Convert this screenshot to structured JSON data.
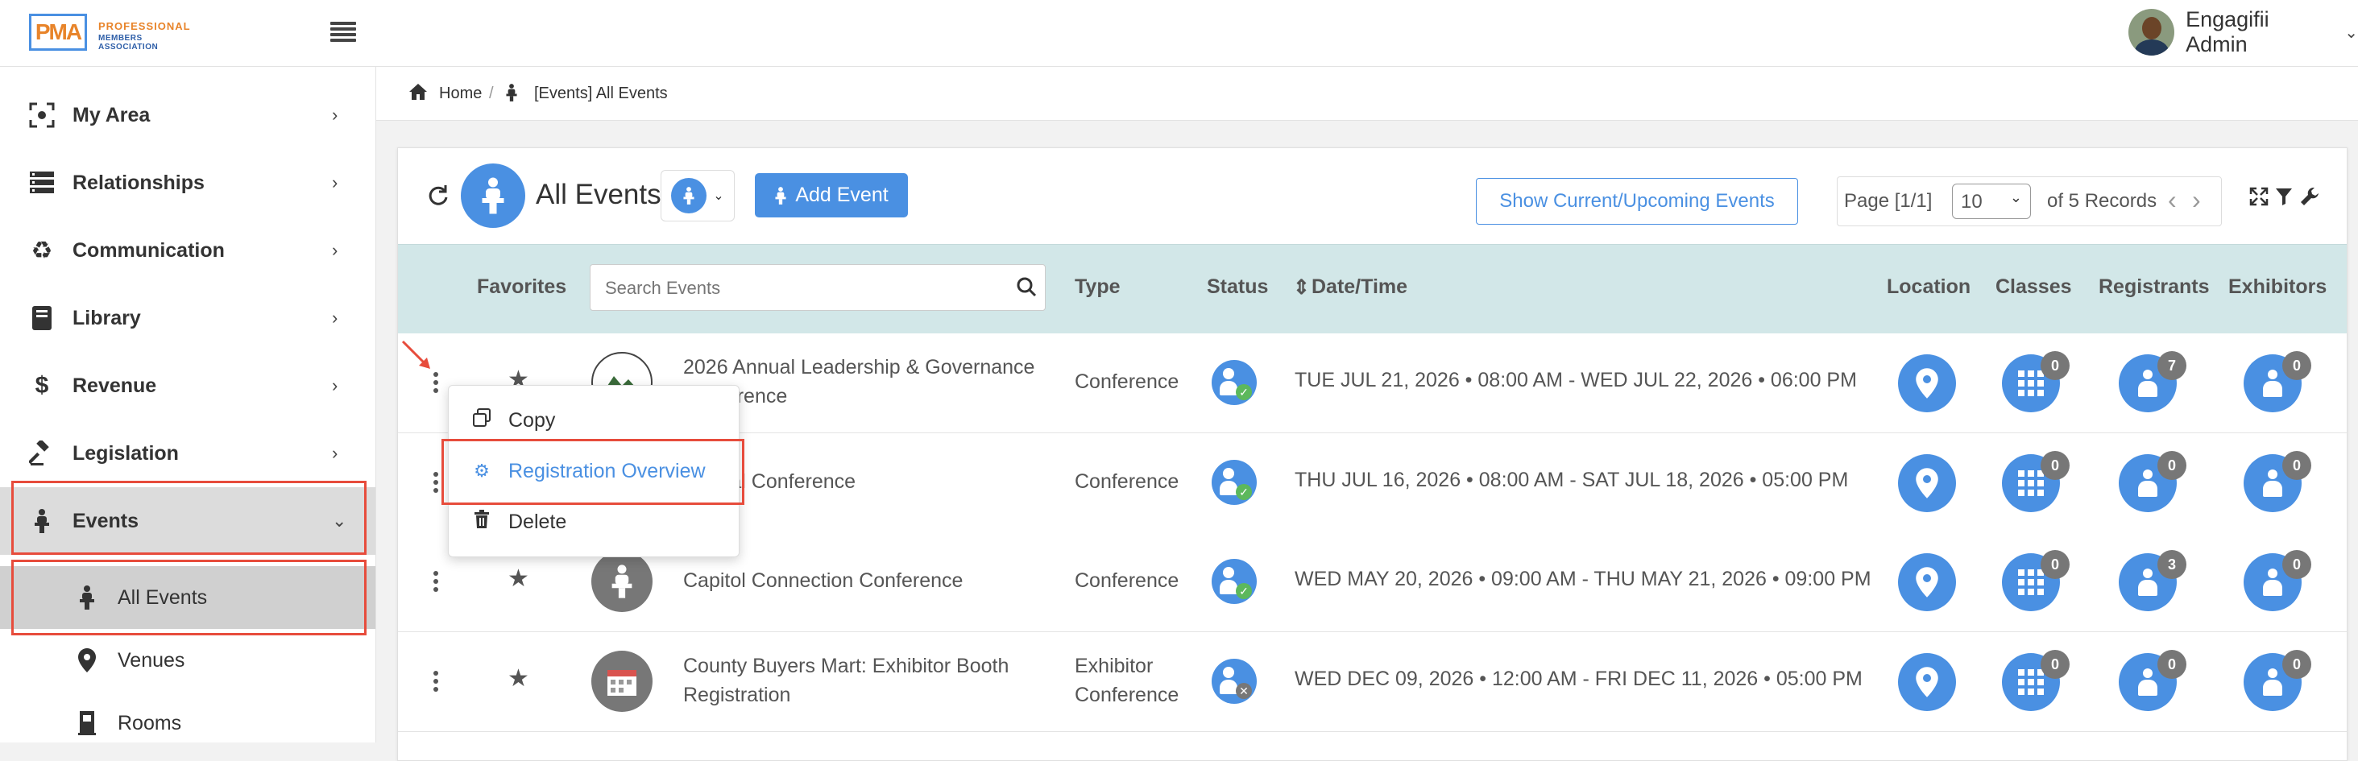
{
  "app": {
    "logo_mark": "PMA",
    "logo_line1": "PROFESSIONAL",
    "logo_line2": "MEMBERS ASSOCIATION",
    "user_name": "Engagifii Admin"
  },
  "sidebar": {
    "items": [
      {
        "label": "My Area",
        "icon": "focus-icon"
      },
      {
        "label": "Relationships",
        "icon": "server-icon"
      },
      {
        "label": "Communication",
        "icon": "recycle-icon"
      },
      {
        "label": "Library",
        "icon": "book-icon"
      },
      {
        "label": "Revenue",
        "icon": "dollar-icon"
      },
      {
        "label": "Legislation",
        "icon": "gavel-icon"
      },
      {
        "label": "Events",
        "icon": "podium-person-icon"
      }
    ],
    "sub_items": [
      {
        "label": "All Events",
        "icon": "podium-person-icon"
      },
      {
        "label": "Venues",
        "icon": "map-pin-icon"
      },
      {
        "label": "Rooms",
        "icon": "door-icon"
      }
    ]
  },
  "breadcrumb": {
    "home": "Home",
    "separator": "/",
    "current": "[Events] All Events"
  },
  "toolbar": {
    "title": "All Events",
    "add_button": "Add Event",
    "show_upcoming": "Show Current/Upcoming Events",
    "page_label": "Page [1/1]",
    "page_size": "10",
    "records": "of 5 Records"
  },
  "table": {
    "headers": {
      "favorites": "Favorites",
      "search_placeholder": "Search Events",
      "type": "Type",
      "status": "Status",
      "date": "Date/Time",
      "location": "Location",
      "classes": "Classes",
      "registrants": "Registrants",
      "exhibitors": "Exhibitors"
    },
    "rows": [
      {
        "name": "2026 Annual Leadership & Governance Conference",
        "type": "Conference",
        "status": "active",
        "date": "TUE JUL 21, 2026 • 08:00 AM - WED JUL 22, 2026 • 06:00 PM",
        "classes": "0",
        "registrants": "7",
        "exhibitors": "0"
      },
      {
        "name": "Annual Conference",
        "type": "Conference",
        "status": "active",
        "date": "THU JUL 16, 2026 • 08:00 AM - SAT JUL 18, 2026 • 05:00 PM",
        "classes": "0",
        "registrants": "0",
        "exhibitors": "0"
      },
      {
        "name": "Capitol Connection Conference",
        "type": "Conference",
        "status": "active",
        "date": "WED MAY 20, 2026 • 09:00 AM - THU MAY 21, 2026 • 09:00 PM",
        "classes": "0",
        "registrants": "3",
        "exhibitors": "0"
      },
      {
        "name": "County Buyers Mart: Exhibitor Booth Registration",
        "type": "Exhibitor Conference",
        "status": "inactive",
        "date": "WED DEC 09, 2026 • 12:00 AM - FRI DEC 11, 2026 • 05:00 PM",
        "classes": "0",
        "registrants": "0",
        "exhibitors": "0"
      }
    ]
  },
  "context_menu": {
    "items": [
      {
        "label": "Copy",
        "icon": "copy-icon"
      },
      {
        "label": "Registration Overview",
        "icon": "gear-icon"
      },
      {
        "label": "Delete",
        "icon": "trash-icon"
      }
    ]
  },
  "colors": {
    "accent": "#4a90e2",
    "highlight": "#e74c3c",
    "table_header_bg": "#d2e7e8"
  }
}
